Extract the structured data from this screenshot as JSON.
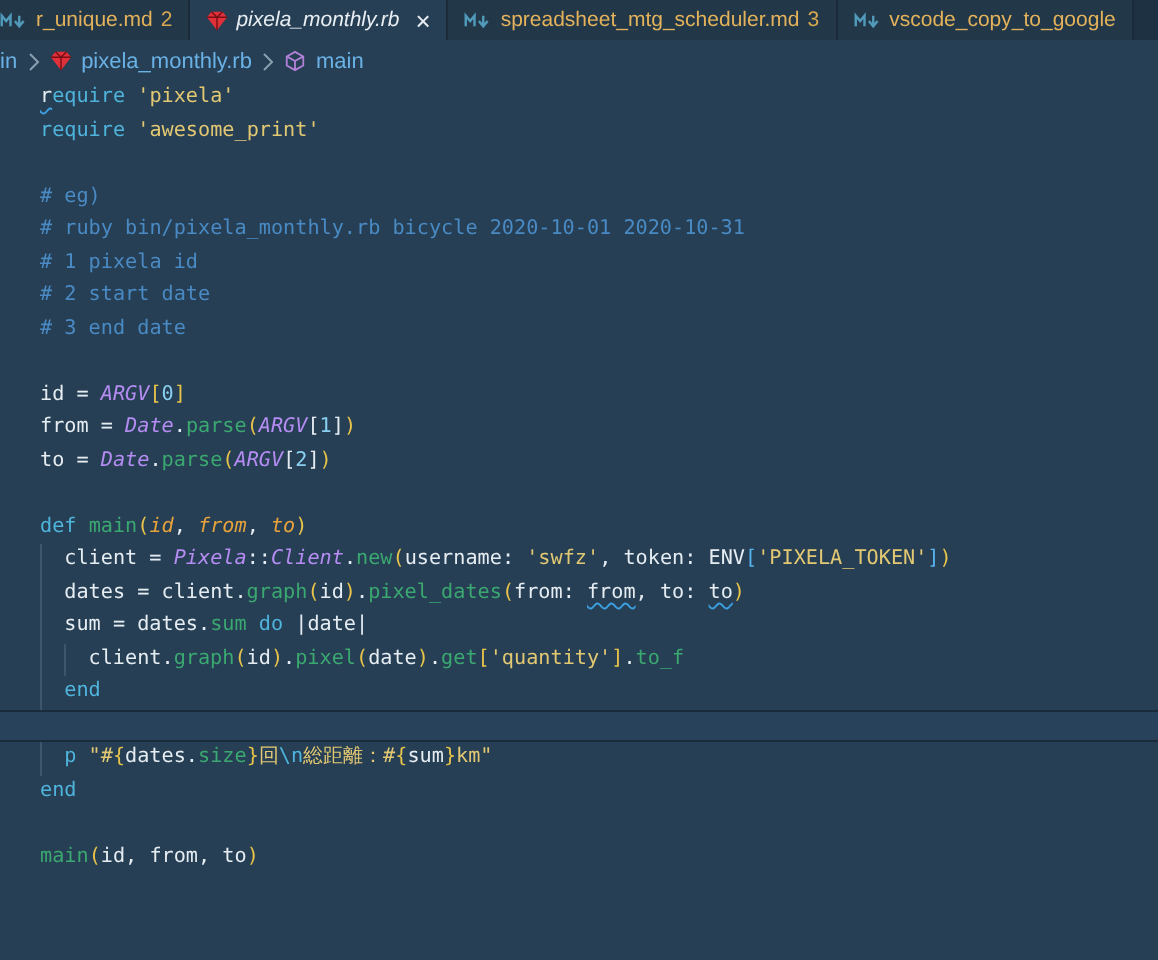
{
  "tabs": [
    {
      "label": "r_unique.md",
      "kind": "markdown",
      "badge": "2",
      "selected": false
    },
    {
      "label": "pixela_monthly.rb",
      "kind": "ruby",
      "selected": true,
      "close": "×"
    },
    {
      "label": "spreadsheet_mtg_scheduler.md",
      "kind": "markdown",
      "badge": "3",
      "selected": false
    },
    {
      "label": "vscode_copy_to_google",
      "kind": "markdown",
      "selected": false
    }
  ],
  "breadcrumb": [
    {
      "label": "in",
      "kind": "folder"
    },
    {
      "label": "pixela_monthly.rb",
      "kind": "ruby"
    },
    {
      "label": "main",
      "kind": "symbol"
    }
  ],
  "lines": [
    {
      "current": false,
      "tokens": [
        {
          "kind": "warn",
          "text": "r"
        },
        {
          "kind": "keyword",
          "text": "equire "
        },
        {
          "kind": "string",
          "text": "'pixela'"
        }
      ]
    },
    {
      "current": false,
      "tokens": [
        {
          "kind": "keyword",
          "text": "require "
        },
        {
          "kind": "string",
          "text": "'awesome_print'"
        }
      ]
    },
    {
      "current": false
    },
    {
      "current": false,
      "tokens": [
        {
          "kind": "comment",
          "text": "# eg)"
        }
      ]
    },
    {
      "current": false,
      "tokens": [
        {
          "kind": "comment",
          "text": "# ruby bin/pixela_monthly.rb bicycle 2020-10-01 2020-10-31"
        }
      ]
    },
    {
      "current": false,
      "tokens": [
        {
          "kind": "comment",
          "text": "# 1 pixela id"
        }
      ]
    },
    {
      "current": false,
      "tokens": [
        {
          "kind": "comment",
          "text": "# 2 start date"
        }
      ]
    },
    {
      "current": false,
      "tokens": [
        {
          "kind": "comment",
          "text": "# 3 end date"
        }
      ]
    },
    {
      "current": false
    },
    {
      "current": false,
      "tokens": [
        {
          "kind": "plain",
          "text": "id = "
        },
        {
          "kind": "constant",
          "text": "ARGV"
        },
        {
          "kind": "bracket",
          "text": "["
        },
        {
          "kind": "number",
          "text": "0"
        },
        {
          "kind": "bracket",
          "text": "]"
        }
      ]
    },
    {
      "current": false,
      "tokens": [
        {
          "kind": "plain",
          "text": "from = "
        },
        {
          "kind": "constant",
          "text": "Date"
        },
        {
          "kind": "plain",
          "text": "."
        },
        {
          "kind": "method",
          "text": "parse"
        },
        {
          "kind": "bracket",
          "text": "("
        },
        {
          "kind": "constant",
          "text": "ARGV"
        },
        {
          "kind": "plain",
          "text": "["
        },
        {
          "kind": "number",
          "text": "1"
        },
        {
          "kind": "plain",
          "text": "]"
        },
        {
          "kind": "bracket",
          "text": ")"
        }
      ]
    },
    {
      "current": false,
      "tokens": [
        {
          "kind": "plain",
          "text": "to = "
        },
        {
          "kind": "constant",
          "text": "Date"
        },
        {
          "kind": "plain",
          "text": "."
        },
        {
          "kind": "method",
          "text": "parse"
        },
        {
          "kind": "bracket",
          "text": "("
        },
        {
          "kind": "constant",
          "text": "ARGV"
        },
        {
          "kind": "plain",
          "text": "["
        },
        {
          "kind": "number",
          "text": "2"
        },
        {
          "kind": "plain",
          "text": "]"
        },
        {
          "kind": "bracket",
          "text": ")"
        }
      ]
    },
    {
      "current": false
    },
    {
      "current": false,
      "tokens": [
        {
          "kind": "keyword",
          "text": "def "
        },
        {
          "kind": "method",
          "text": "main"
        },
        {
          "kind": "bracket",
          "text": "("
        },
        {
          "kind": "param",
          "text": "id"
        },
        {
          "kind": "plain",
          "text": ", "
        },
        {
          "kind": "param",
          "text": "from"
        },
        {
          "kind": "plain",
          "text": ", "
        },
        {
          "kind": "param",
          "text": "to"
        },
        {
          "kind": "bracket",
          "text": ")"
        }
      ]
    },
    {
      "current": false,
      "tokens": [
        {
          "kind": "plain",
          "text": "  client = "
        },
        {
          "kind": "constant",
          "text": "Pixela"
        },
        {
          "kind": "plain",
          "text": "::"
        },
        {
          "kind": "constant",
          "text": "Client"
        },
        {
          "kind": "plain",
          "text": "."
        },
        {
          "kind": "method",
          "text": "new"
        },
        {
          "kind": "bracket",
          "text": "("
        },
        {
          "kind": "plain",
          "text": "username: "
        },
        {
          "kind": "string",
          "text": "'swfz'"
        },
        {
          "kind": "plain",
          "text": ", token: ENV"
        },
        {
          "kind": "bracket2",
          "text": "["
        },
        {
          "kind": "string",
          "text": "'PIXELA_TOKEN'"
        },
        {
          "kind": "bracket2",
          "text": "]"
        },
        {
          "kind": "bracket",
          "text": ")"
        }
      ]
    },
    {
      "current": false,
      "tokens": [
        {
          "kind": "plain",
          "text": "  dates = client."
        },
        {
          "kind": "method",
          "text": "graph"
        },
        {
          "kind": "bracket",
          "text": "("
        },
        {
          "kind": "plain",
          "text": "id"
        },
        {
          "kind": "bracket",
          "text": ")"
        },
        {
          "kind": "plain",
          "text": "."
        },
        {
          "kind": "method",
          "text": "pixel_dates"
        },
        {
          "kind": "bracket",
          "text": "("
        },
        {
          "kind": "plain",
          "text": "from: "
        },
        {
          "kind": "warn",
          "text": "from"
        },
        {
          "kind": "plain",
          "text": ", to: "
        },
        {
          "kind": "warn",
          "text": "to"
        },
        {
          "kind": "bracket",
          "text": ")"
        }
      ]
    },
    {
      "current": false,
      "tokens": [
        {
          "kind": "plain",
          "text": "  sum = dates."
        },
        {
          "kind": "method",
          "text": "sum"
        },
        {
          "kind": "keyword",
          "text": " do "
        },
        {
          "kind": "plain",
          "text": "|date|"
        }
      ]
    },
    {
      "current": false,
      "tokens": [
        {
          "kind": "plain",
          "text": "    client."
        },
        {
          "kind": "method",
          "text": "graph"
        },
        {
          "kind": "bracket",
          "text": "("
        },
        {
          "kind": "plain",
          "text": "id"
        },
        {
          "kind": "bracket",
          "text": ")"
        },
        {
          "kind": "plain",
          "text": "."
        },
        {
          "kind": "method",
          "text": "pixel"
        },
        {
          "kind": "bracket",
          "text": "("
        },
        {
          "kind": "plain",
          "text": "date"
        },
        {
          "kind": "bracket",
          "text": ")"
        },
        {
          "kind": "plain",
          "text": "."
        },
        {
          "kind": "method",
          "text": "get"
        },
        {
          "kind": "bracket",
          "text": "["
        },
        {
          "kind": "string",
          "text": "'quantity'"
        },
        {
          "kind": "bracket",
          "text": "]"
        },
        {
          "kind": "plain",
          "text": "."
        },
        {
          "kind": "method",
          "text": "to_f"
        }
      ]
    },
    {
      "current": false,
      "tokens": [
        {
          "kind": "keyword",
          "text": "  end"
        }
      ]
    },
    {
      "current": true
    },
    {
      "current": false,
      "tokens": [
        {
          "kind": "keyword",
          "text": "  p "
        },
        {
          "kind": "string",
          "text": "\"#"
        },
        {
          "kind": "bracket",
          "text": "{"
        },
        {
          "kind": "plain",
          "text": "dates."
        },
        {
          "kind": "method",
          "text": "size"
        },
        {
          "kind": "bracket",
          "text": "}"
        },
        {
          "kind": "string",
          "text": "回"
        },
        {
          "kind": "keyword",
          "text": "\\n"
        },
        {
          "kind": "string",
          "text": "総距離：#"
        },
        {
          "kind": "bracket",
          "text": "{"
        },
        {
          "kind": "plain",
          "text": "sum"
        },
        {
          "kind": "bracket",
          "text": "}"
        },
        {
          "kind": "string",
          "text": "km\""
        }
      ]
    },
    {
      "current": false,
      "tokens": [
        {
          "kind": "keyword",
          "text": "end"
        }
      ]
    },
    {
      "current": false
    },
    {
      "current": false,
      "tokens": [
        {
          "kind": "method",
          "text": "main"
        },
        {
          "kind": "bracket",
          "text": "("
        },
        {
          "kind": "plain",
          "text": "id, from, to"
        },
        {
          "kind": "bracket",
          "text": ")"
        }
      ]
    }
  ]
}
